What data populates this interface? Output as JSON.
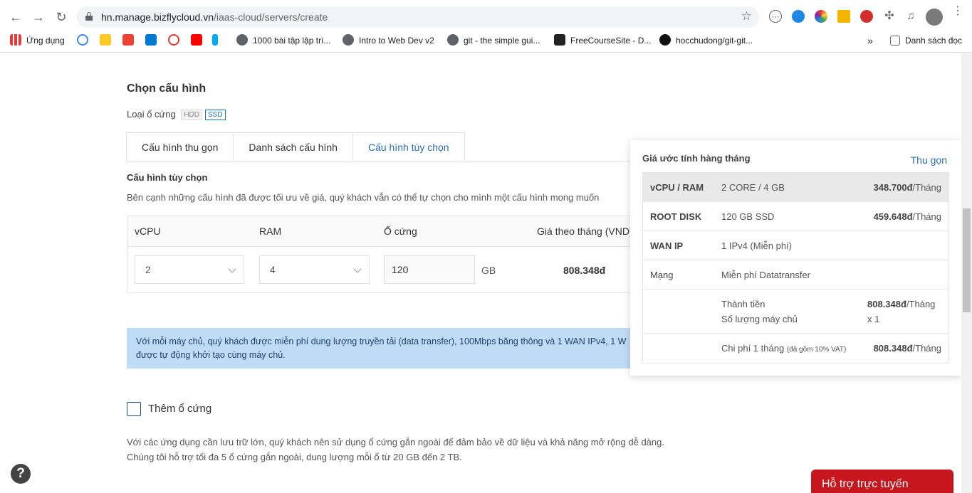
{
  "browser": {
    "url_domain": "hn.manage.bizflycloud.vn",
    "url_path": "/iaas-cloud/servers/create",
    "bookmarks": [
      {
        "label": "Ứng dụng"
      },
      {
        "label": "1000 bài tập lập trì..."
      },
      {
        "label": "Intro to Web Dev v2"
      },
      {
        "label": "git - the simple gui..."
      },
      {
        "label": "FreeCourseSite - D..."
      },
      {
        "label": "hocchudong/git-git..."
      }
    ],
    "overflow": "»",
    "reading_list": "Danh sách đọc"
  },
  "config": {
    "title": "Chọn cấu hình",
    "disk_type_label": "Loại ổ cứng",
    "disk_types": [
      "HDD",
      "SSD"
    ],
    "tabs": [
      "Cấu hình thu gọn",
      "Danh sách cấu hình",
      "Cấu hình tùy chọn"
    ],
    "custom_title": "Cấu hình tùy chọn",
    "custom_desc": "Bên cạnh những cấu hình đã được tối ưu về giá, quý khách vẫn có thể tự chọn cho mình một cấu hình mong muốn",
    "headers": {
      "vcpu": "vCPU",
      "ram": "RAM",
      "disk": "Ổ cứng",
      "price": "Giá theo tháng (VND)"
    },
    "vcpu": "2",
    "ram": "4",
    "disk": "120",
    "disk_unit": "GB",
    "price": "808.348đ"
  },
  "alert": {
    "text": "Với mỗi máy chủ, quý khách được miễn phí dung lượng truyền tải (data transfer), 100Mbps băng thông và 1 WAN IPv4, 1 W",
    "text2": "được tự động khởi tạo cùng máy chủ."
  },
  "add_disk": {
    "label": "Thêm ổ cứng",
    "desc1": "Với các ứng dụng cần lưu trữ lớn, quý khách nên sử dụng ổ cứng gắn ngoài để đảm bảo về dữ liệu và khả năng mở rộng dễ dàng.",
    "desc2": "Chúng tôi hỗ trợ tối đa 5 ổ cứng gắn ngoài, dung lượng mỗi ổ từ 20 GB đến 2 TB."
  },
  "panel": {
    "title": "Giá ước tính hàng tháng",
    "collapse": "Thu gọn",
    "rows": [
      {
        "key": "vCPU / RAM",
        "val": "2 CORE / 4 GB",
        "price": "348.700đ",
        "unit": "/Tháng"
      },
      {
        "key": "ROOT DISK",
        "val": "120 GB SSD",
        "price": "459.648đ",
        "unit": "/Tháng"
      },
      {
        "key": "WAN IP",
        "val": "1 IPv4 (Miễn phí)"
      },
      {
        "key": "Mạng",
        "val": "Miễn phí Datatransfer"
      }
    ],
    "total_label": "Thành tiền",
    "total_price": "808.348đ",
    "total_unit": "/Tháng",
    "qty_label": "Số lượng máy chủ",
    "qty": "x 1",
    "monthly_label": "Chi phí 1 tháng",
    "monthly_note": "(đã gồm 10% VAT)",
    "monthly_price": "808.348đ",
    "monthly_unit": "/Tháng"
  },
  "support": {
    "label": "Hỗ trợ trực tuyến"
  },
  "help": {
    "glyph": "?"
  }
}
